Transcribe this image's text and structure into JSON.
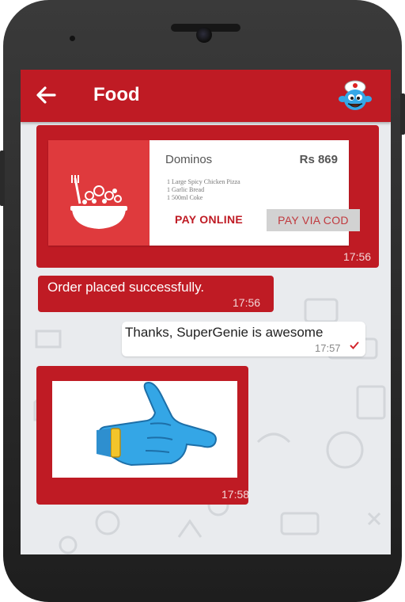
{
  "app": {
    "title": "Food",
    "back_icon": "arrow-left-icon",
    "avatar_icon": "genie-avatar-icon",
    "accent_color": "#bf1b24"
  },
  "messages": {
    "order_card": {
      "restaurant": "Dominos",
      "price": "Rs 869",
      "items": [
        "1 Large Spicy Chicken Pizza",
        "1 Garlic Bread",
        "1 500ml Coke"
      ],
      "pay_online_label": "PAY ONLINE",
      "pay_cod_label": "PAY VIA COD",
      "time": "17:56",
      "image_icon": "food-bowl-icon"
    },
    "confirmation": {
      "text": "Order placed successfully.",
      "time": "17:56"
    },
    "user_reply": {
      "text": "Thanks, SuperGenie is awesome",
      "time": "17:57",
      "status_icon": "check-icon"
    },
    "sticker": {
      "time": "17:58",
      "image_icon": "pointing-hand-sticker-icon"
    }
  }
}
